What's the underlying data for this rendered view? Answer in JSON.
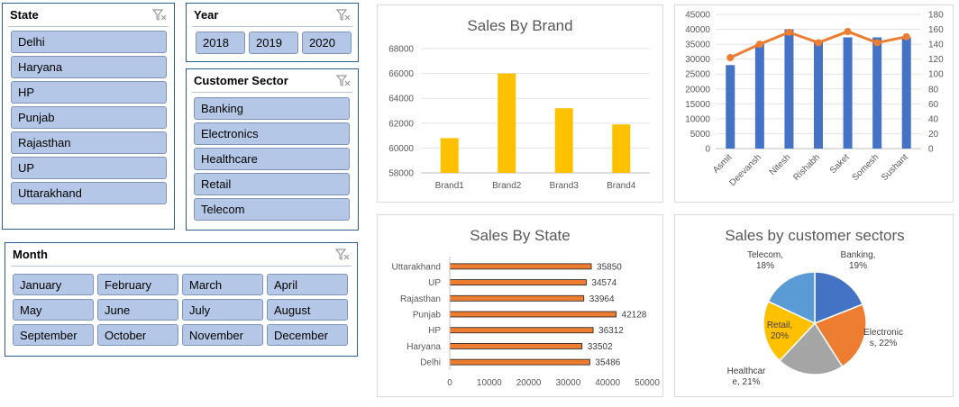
{
  "slicers": {
    "state": {
      "title": "State",
      "items": [
        "Delhi",
        "Haryana",
        "HP",
        "Punjab",
        "Rajasthan",
        "UP",
        "Uttarakhand"
      ]
    },
    "year": {
      "title": "Year",
      "items": [
        "2018",
        "2019",
        "2020"
      ]
    },
    "customer_sector": {
      "title": "Customer Sector",
      "items": [
        "Banking",
        "Electronics",
        "Healthcare",
        "Retail",
        "Telecom"
      ]
    },
    "month": {
      "title": "Month",
      "items": [
        "January",
        "February",
        "March",
        "April",
        "May",
        "June",
        "July",
        "August",
        "September",
        "October",
        "November",
        "December"
      ]
    }
  },
  "icons": {
    "slicer_clear": "clear-filter-icon"
  },
  "colors": {
    "slicer_tile": "#b4c7e7",
    "slicer_border": "#2e5c8a",
    "brand_bars": "#ffc000",
    "combo_bars": "#4472c4",
    "combo_line": "#ed7d31",
    "state_bars": "#ed7d31"
  },
  "chart_data": [
    {
      "type": "bar",
      "title": "Sales By Brand",
      "categories": [
        "Brand1",
        "Brand2",
        "Brand3",
        "Brand4"
      ],
      "values": [
        60800,
        66000,
        63200,
        61900
      ],
      "ylim": [
        58000,
        68000
      ],
      "yticks": [
        "58000",
        "60000",
        "62000",
        "64000",
        "66000",
        "68000"
      ],
      "grid": true,
      "legend": "none"
    },
    {
      "type": "bar",
      "title": "",
      "categories": [
        "Asmit",
        "Deevansh",
        "Nitesh",
        "Rishabh",
        "Saket",
        "Somesh",
        "Sushant"
      ],
      "series": [
        {
          "type": "bar",
          "axis": "left",
          "values": [
            28000,
            35000,
            40000,
            36000,
            37300,
            37300,
            37300
          ]
        },
        {
          "type": "line",
          "axis": "right",
          "values": [
            122,
            140,
            156,
            142,
            157,
            142,
            150
          ]
        }
      ],
      "ylim_left": [
        0,
        45000
      ],
      "yticks_left": [
        "0",
        "5000",
        "10000",
        "15000",
        "20000",
        "25000",
        "30000",
        "35000",
        "40000",
        "45000"
      ],
      "ylim_right": [
        0,
        180
      ],
      "yticks_right": [
        "0",
        "20",
        "40",
        "60",
        "80",
        "100",
        "120",
        "140",
        "160",
        "180"
      ],
      "grid": true
    },
    {
      "type": "bar",
      "orientation": "horizontal",
      "title": "Sales By State",
      "categories": [
        "Uttarakhand",
        "UP",
        "Rajasthan",
        "Punjab",
        "HP",
        "Haryana",
        "Delhi"
      ],
      "values": [
        35850,
        34574,
        33964,
        42128,
        36312,
        33502,
        35486
      ],
      "data_labels": [
        "35850",
        "34574",
        "33964",
        "42128",
        "36312",
        "33502",
        "35486"
      ],
      "xlim": [
        0,
        50000
      ],
      "xticks": [
        "0",
        "10000",
        "20000",
        "30000",
        "40000",
        "50000"
      ],
      "grid": false
    },
    {
      "type": "pie",
      "title": "Sales by customer sectors",
      "slices": [
        {
          "name": "Banking",
          "value": 19,
          "color": "#4472c4",
          "label": [
            "Banking,",
            "19%"
          ]
        },
        {
          "name": "Electronics",
          "value": 22,
          "color": "#ed7d31",
          "label": [
            "Electronic",
            "s, 22%"
          ]
        },
        {
          "name": "Healthcare",
          "value": 21,
          "color": "#a5a5a5",
          "label": [
            "Healthcar",
            "e, 21%"
          ]
        },
        {
          "name": "Retail",
          "value": 20,
          "color": "#ffc000",
          "label": [
            "Retail,",
            "20%"
          ]
        },
        {
          "name": "Telecom",
          "value": 18,
          "color": "#5b9bd5",
          "label": [
            "Telecom,",
            "18%"
          ]
        }
      ]
    }
  ]
}
